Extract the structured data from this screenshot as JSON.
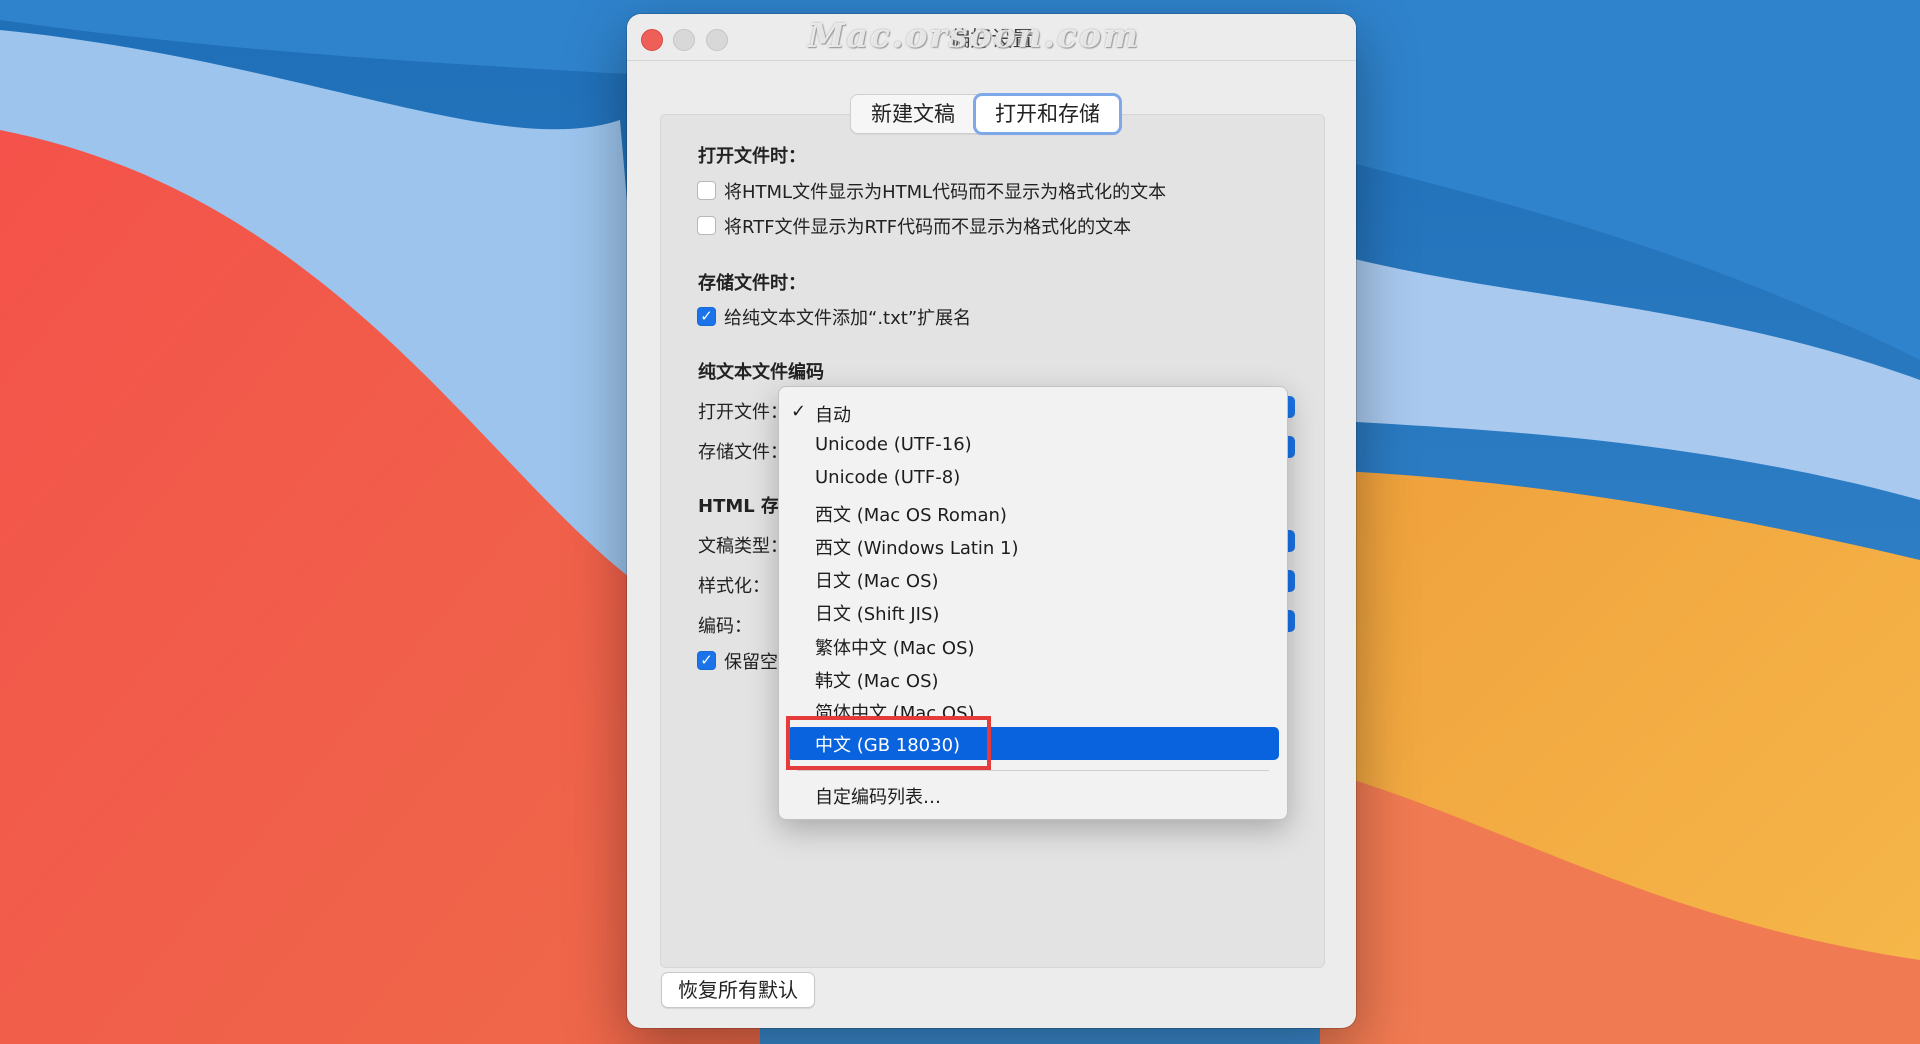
{
  "window": {
    "title": "偏好设置",
    "watermark": "Mac.orsoon.com"
  },
  "tabs": [
    {
      "label": "新建文稿",
      "active": false
    },
    {
      "label": "打开和存储",
      "active": true
    }
  ],
  "open_section": {
    "heading": "打开文件时：",
    "options": [
      {
        "label": "将HTML文件显示为HTML代码而不显示为格式化的文本",
        "checked": false
      },
      {
        "label": "将RTF文件显示为RTF代码而不显示为格式化的文本",
        "checked": false
      }
    ]
  },
  "save_section": {
    "heading": "存储文件时：",
    "options": [
      {
        "label": "给纯文本文件添加“.txt”扩展名",
        "checked": true
      }
    ]
  },
  "encoding_section": {
    "heading": "纯文本文件编码",
    "open_label": "打开文件：",
    "save_label": "存储文件："
  },
  "html_section": {
    "heading": "HTML 存",
    "doctype_label": "文稿类型：",
    "styling_label": "样式化：",
    "encoding_label": "编码：",
    "preserve_label": "保留空",
    "preserve_checked": true
  },
  "restore_button": "恢复所有默认",
  "menu": {
    "items": [
      {
        "label": "自动",
        "checked": true
      },
      {
        "label": "Unicode (UTF-16)"
      },
      {
        "label": "Unicode (UTF-8)"
      },
      {
        "label": "西文 (Mac OS Roman)"
      },
      {
        "label": "西文 (Windows Latin 1)"
      },
      {
        "label": "日文 (Mac OS)"
      },
      {
        "label": "日文 (Shift JIS)"
      },
      {
        "label": "繁体中文 (Mac OS)"
      },
      {
        "label": "韩文 (Mac OS)"
      },
      {
        "label": "简体中文 (Mac OS)"
      }
    ],
    "highlighted": "中文 (GB 18030)",
    "customize": "自定编码列表…",
    "check_glyph": "✓"
  },
  "colors": {
    "accent": "#0a63de",
    "annotation": "#e53b3b",
    "close": "#ee5f57"
  }
}
